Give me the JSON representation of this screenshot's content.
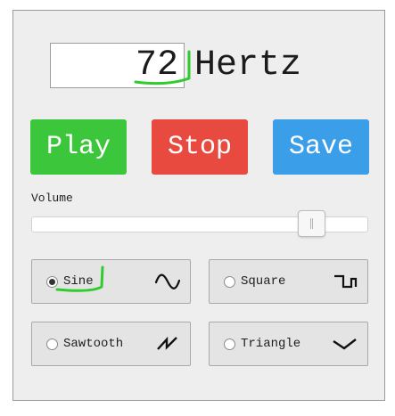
{
  "frequency": {
    "value": "72",
    "unit": "Hertz"
  },
  "buttons": {
    "play": "Play",
    "stop": "Stop",
    "save": "Save"
  },
  "colors": {
    "play": "#3bc63b",
    "stop": "#e84a3f",
    "save": "#3a9ee8",
    "annotation": "#2ecc2e"
  },
  "volume": {
    "label": "Volume",
    "level_fraction": 0.83
  },
  "waveforms": [
    {
      "label": "Sine",
      "selected": true,
      "icon": "sine-wave-icon"
    },
    {
      "label": "Square",
      "selected": false,
      "icon": "square-wave-icon"
    },
    {
      "label": "Sawtooth",
      "selected": false,
      "icon": "sawtooth-wave-icon"
    },
    {
      "label": "Triangle",
      "selected": false,
      "icon": "triangle-wave-icon"
    }
  ]
}
